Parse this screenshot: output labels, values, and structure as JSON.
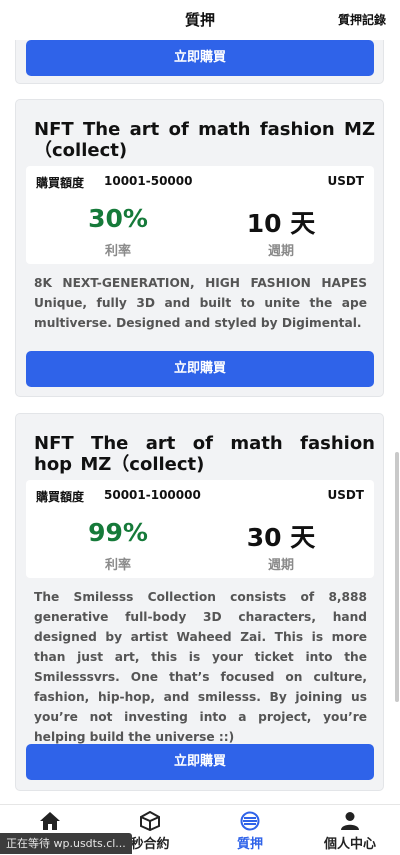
{
  "header": {
    "title": "質押",
    "records_label": "質押記錄"
  },
  "buy_label": "立即購買",
  "cards": [
    {
      "title": "NFT The art of math fashion MZ（collect)",
      "amount_label": "購買額度",
      "amount_value": "10001-50000",
      "currency": "USDT",
      "rate_value": "30%",
      "rate_label": "利率",
      "period_value": "10 天",
      "period_label": "週期",
      "description": "8K NEXT-GENERATION, HIGH FASHION HAPES Unique, fully 3D and built to unite the ape multiverse. Designed and styled by Digimental.",
      "button_label": "立即購買"
    },
    {
      "title": "NFT The art of math fashion hop MZ（collect)",
      "amount_label": "購買額度",
      "amount_value": "50001-100000",
      "currency": "USDT",
      "rate_value": "99%",
      "rate_label": "利率",
      "period_value": "30 天",
      "period_label": "週期",
      "description": "The Smilesss Collection consists of 8,888 generative full-body 3D characters, hand designed by artist Waheed Zai. This is more than just art, this is your ticket into the Smilesssvrs. One that’s focused on culture, fashion, hip-hop, and smilesss. By joining us you’re not investing into a project, you’re helping build the universe ::)",
      "button_label": "立即購買"
    }
  ],
  "tabbar": {
    "items": [
      {
        "label": "",
        "icon": "home-icon"
      },
      {
        "label": "秒合約",
        "icon": "cube-icon"
      },
      {
        "label": "質押",
        "icon": "stake-icon"
      },
      {
        "label": "個人中心",
        "icon": "user-icon"
      }
    ],
    "active_color": "#2f63e9"
  },
  "status_text": "正在等待 wp.usdts.cl...",
  "colors": {
    "accent": "#2f63e9",
    "rate_green": "#167a3a"
  }
}
